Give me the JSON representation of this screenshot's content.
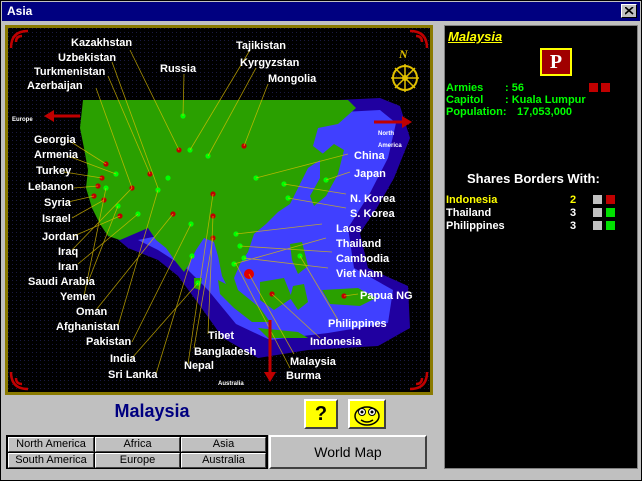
{
  "window": {
    "title": "Asia"
  },
  "map": {
    "labels": [
      {
        "key": "kazakhstan",
        "text": "Kazakhstan"
      },
      {
        "key": "tajikistan",
        "text": "Tajikistan"
      },
      {
        "key": "uzbekistan",
        "text": "Uzbekistan"
      },
      {
        "key": "kyrgyzstan",
        "text": "Kyrgyzstan"
      },
      {
        "key": "turkmenistan",
        "text": "Turkmenistan"
      },
      {
        "key": "russia",
        "text": "Russia"
      },
      {
        "key": "mongolia",
        "text": "Mongolia"
      },
      {
        "key": "azerbaijan",
        "text": "Azerbaijan"
      },
      {
        "key": "georgia",
        "text": "Georgia"
      },
      {
        "key": "armenia",
        "text": "Armenia"
      },
      {
        "key": "turkey",
        "text": "Turkey"
      },
      {
        "key": "lebanon",
        "text": "Lebanon"
      },
      {
        "key": "syria",
        "text": "Syria"
      },
      {
        "key": "israel",
        "text": "Israel"
      },
      {
        "key": "jordan",
        "text": "Jordan"
      },
      {
        "key": "iraq",
        "text": "Iraq"
      },
      {
        "key": "iran",
        "text": "Iran"
      },
      {
        "key": "saudi_arabia",
        "text": "Saudi Arabia"
      },
      {
        "key": "yemen",
        "text": "Yemen"
      },
      {
        "key": "oman",
        "text": "Oman"
      },
      {
        "key": "afghanistan",
        "text": "Afghanistan"
      },
      {
        "key": "pakistan",
        "text": "Pakistan"
      },
      {
        "key": "india",
        "text": "India"
      },
      {
        "key": "sri_lanka",
        "text": "Sri Lanka"
      },
      {
        "key": "nepal",
        "text": "Nepal"
      },
      {
        "key": "bangladesh",
        "text": "Bangladesh"
      },
      {
        "key": "tibet",
        "text": "Tibet"
      },
      {
        "key": "malaysia",
        "text": "Malaysia"
      },
      {
        "key": "burma",
        "text": "Burma"
      },
      {
        "key": "indonesia",
        "text": "Indonesia"
      },
      {
        "key": "philippines",
        "text": "Philippines"
      },
      {
        "key": "papua_ng",
        "text": "Papua NG"
      },
      {
        "key": "vietnam",
        "text": "Viet Nam"
      },
      {
        "key": "cambodia",
        "text": "Cambodia"
      },
      {
        "key": "thailand",
        "text": "Thailand"
      },
      {
        "key": "laos",
        "text": "Laos"
      },
      {
        "key": "s_korea",
        "text": "S. Korea"
      },
      {
        "key": "n_korea",
        "text": "N. Korea"
      },
      {
        "key": "japan",
        "text": "Japan"
      },
      {
        "key": "china",
        "text": "China"
      }
    ],
    "edge_labels": {
      "europe": "Europe",
      "north_america": "North America",
      "australia": "Australia"
    },
    "compass_letter": "N"
  },
  "info": {
    "country": "Malaysia",
    "flag_letter": "P",
    "armies_label": "Armies",
    "armies_value": ": 56",
    "capitol_label": "Capitol",
    "capitol_value": ": Kuala Lumpur",
    "population_label": "Population:",
    "population_value": "17,053,000",
    "borders_title": "Shares Borders With:",
    "borders": [
      {
        "name": "Indonesia",
        "count": "2",
        "color": "#ffff00",
        "status_color": "#c00000"
      },
      {
        "name": "Thailand",
        "count": "3",
        "color": "#ffffff",
        "status_color": "#00e000"
      },
      {
        "name": "Philippines",
        "count": "3",
        "color": "#ffffff",
        "status_color": "#00e000"
      }
    ]
  },
  "selected_country_label": "Malaysia",
  "buttons": {
    "help_label": "?",
    "world_map_label": "World Map"
  },
  "regions": {
    "north_america": "North America",
    "africa": "Africa",
    "asia": "Asia",
    "south_america": "South America",
    "europe": "Europe",
    "australia": "Australia"
  },
  "colors": {
    "land": "#2aa000",
    "water_shallow": "#4040ff",
    "water_deep": "#2000a0",
    "title_bar": "#000080",
    "frame_gold": "#8a7a00",
    "stats_green": "#00ff00",
    "army_red": "#c00000"
  }
}
